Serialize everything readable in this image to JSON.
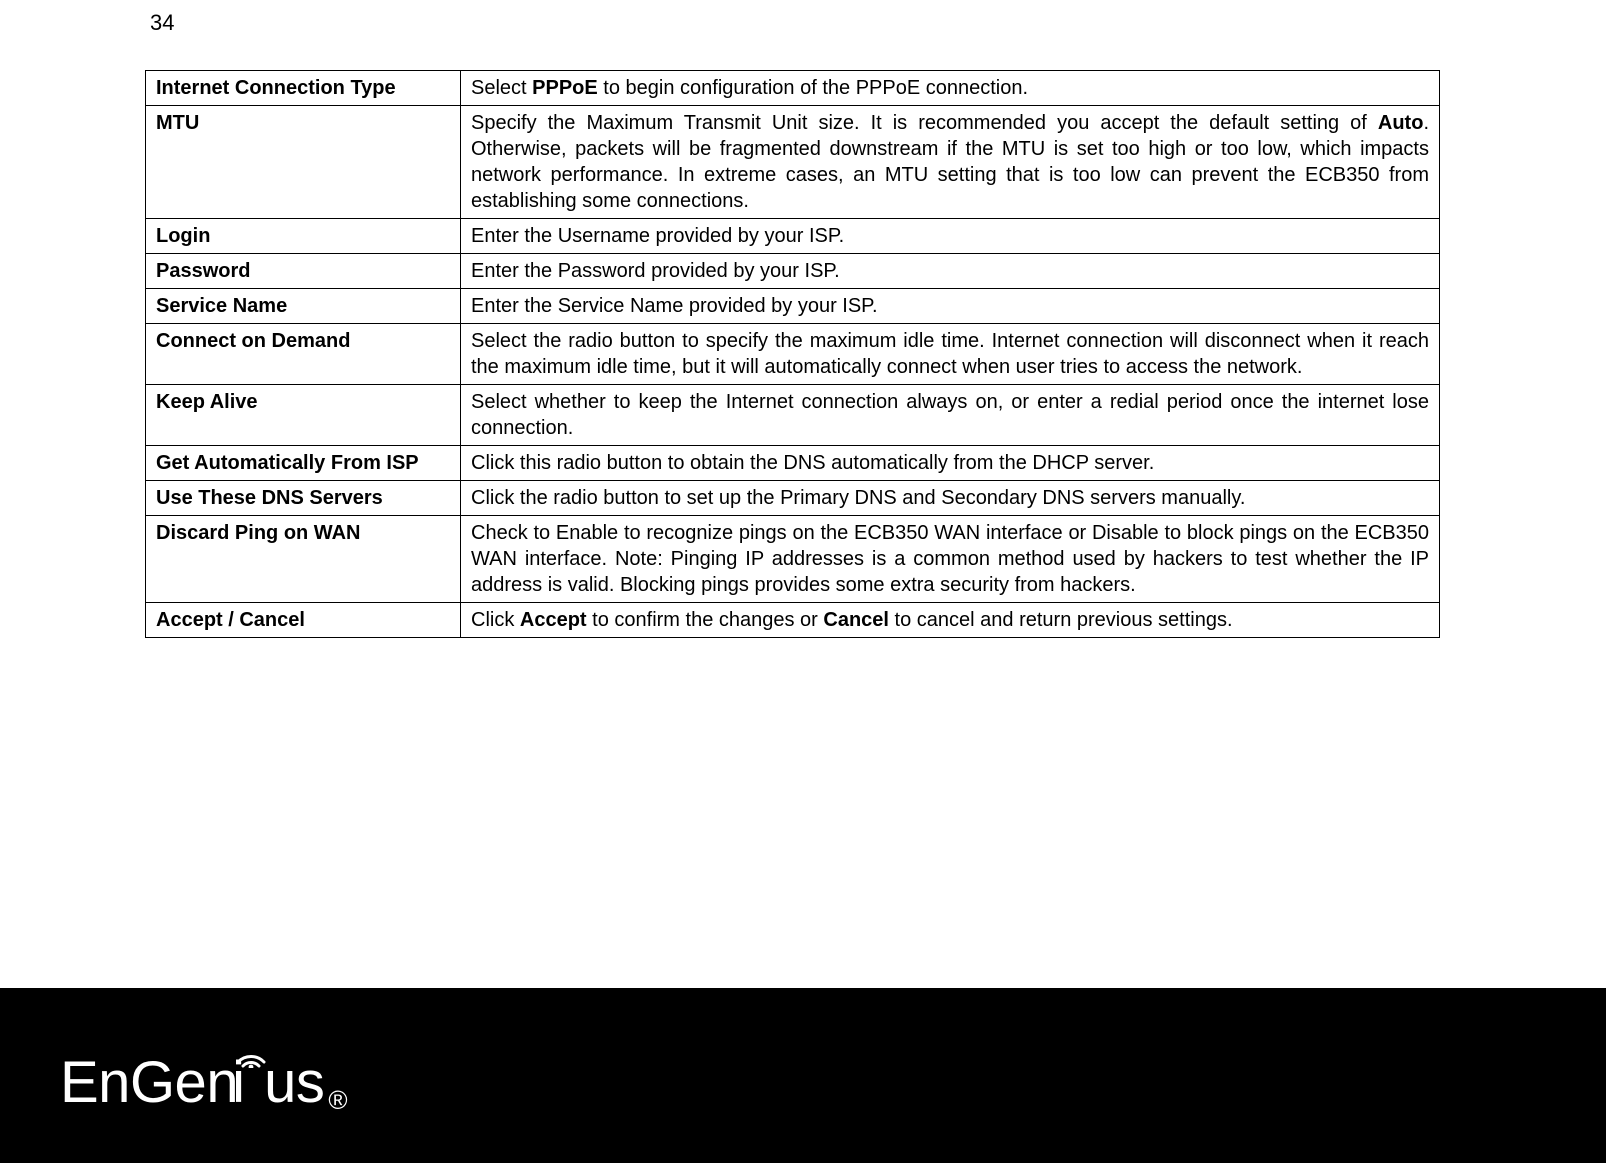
{
  "page_number": "34",
  "table": {
    "rows": [
      {
        "label": "Internet Connection Type",
        "desc_parts": [
          {
            "t": "Select ",
            "b": false
          },
          {
            "t": "PPPoE",
            "b": true
          },
          {
            "t": " to begin configuration of the PPPoE connection.",
            "b": false
          }
        ]
      },
      {
        "label": "MTU",
        "desc_parts": [
          {
            "t": "Specify the Maximum Transmit Unit size. It is recommended you accept the default setting of ",
            "b": false
          },
          {
            "t": "Auto",
            "b": true
          },
          {
            "t": ". Otherwise, packets will be fragmented downstream if the MTU is set too high or too low, which impacts network performance. In extreme cases, an MTU setting that is too low can prevent the ECB350 from establishing some connections.",
            "b": false
          }
        ]
      },
      {
        "label": "Login",
        "desc_parts": [
          {
            "t": "Enter the Username provided by your ISP.",
            "b": false
          }
        ]
      },
      {
        "label": "Password",
        "desc_parts": [
          {
            "t": "Enter the Password provided by your ISP.",
            "b": false
          }
        ]
      },
      {
        "label": "Service Name",
        "desc_parts": [
          {
            "t": "Enter the Service Name provided by your ISP.",
            "b": false
          }
        ]
      },
      {
        "label": "Connect on Demand",
        "desc_parts": [
          {
            "t": "Select the radio button to specify the maximum idle time. Internet connection will disconnect when it reach the maximum idle time, but it will automatically connect when user tries to access the network.",
            "b": false
          }
        ]
      },
      {
        "label": "Keep Alive",
        "desc_parts": [
          {
            "t": "Select whether to keep the Internet connection always on, or enter a redial period once the internet lose connection.",
            "b": false
          }
        ]
      },
      {
        "label": "Get Automatically From ISP",
        "desc_parts": [
          {
            "t": "Click this radio button to obtain the DNS automatically from the DHCP server.",
            "b": false
          }
        ]
      },
      {
        "label": "Use These DNS Servers",
        "desc_parts": [
          {
            "t": "Click the radio button to set up the Primary DNS and Secondary DNS servers manually.",
            "b": false
          }
        ]
      },
      {
        "label": "Discard Ping on WAN",
        "desc_parts": [
          {
            "t": "Check to Enable to recognize pings on the ECB350 WAN interface or Disable to block pings on the ECB350 WAN interface. Note: Pinging IP addresses is a common method used by hackers to test whether the IP address is valid. Blocking pings provides some extra security from hackers.",
            "b": false
          }
        ]
      },
      {
        "label": "Accept / Cancel",
        "desc_parts": [
          {
            "t": "Click ",
            "b": false
          },
          {
            "t": "Accept",
            "b": true
          },
          {
            "t": " to confirm the changes or ",
            "b": false
          },
          {
            "t": "Cancel",
            "b": true
          },
          {
            "t": " to cancel and return previous settings.",
            "b": false
          }
        ]
      }
    ]
  },
  "footer": {
    "brand_left": "EnGen",
    "brand_right": "us",
    "registered": "®"
  }
}
